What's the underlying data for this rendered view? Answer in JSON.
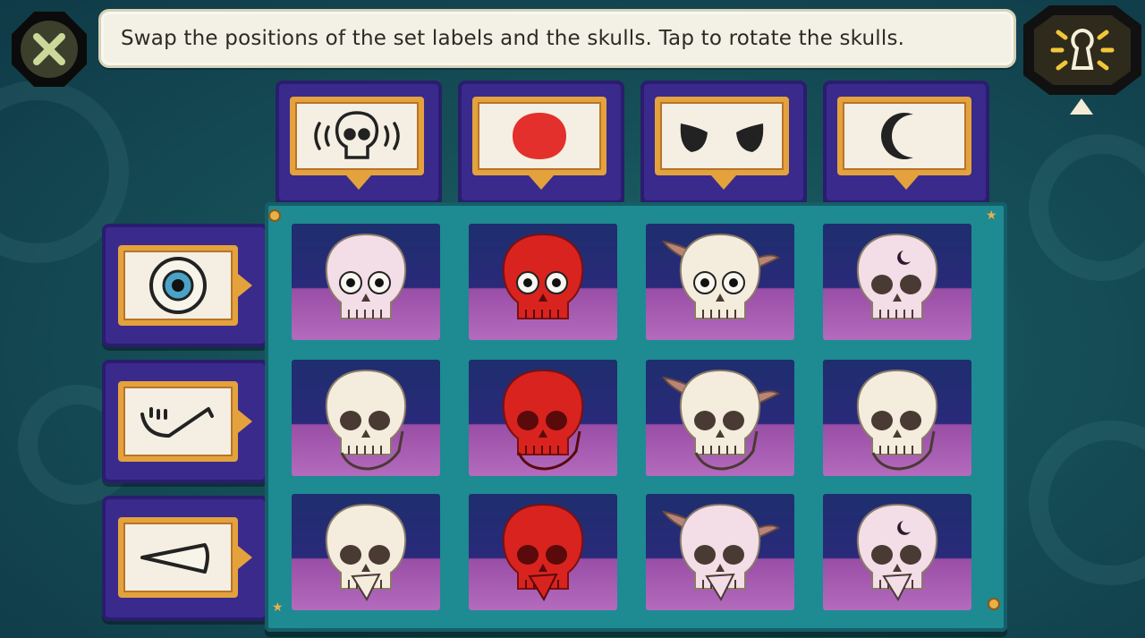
{
  "instruction": "Swap the positions of the set labels and the skulls. Tap to rotate the skulls.",
  "colors": {
    "shelf": "#1e8a92",
    "panel": "#3a2a8c",
    "label_frame": "#e4a23c",
    "skull_white": "#f4ecdc",
    "skull_pink": "#f3dde6",
    "skull_red": "#d8231f",
    "horn": "#b98578"
  },
  "column_labels": [
    {
      "icon": "shaking-skull-icon"
    },
    {
      "icon": "red-blob-icon"
    },
    {
      "icon": "angry-eyes-icon"
    },
    {
      "icon": "crescent-moon-icon"
    }
  ],
  "row_labels": [
    {
      "icon": "eyeball-icon"
    },
    {
      "icon": "jaw-icon"
    },
    {
      "icon": "beak-icon"
    }
  ],
  "skulls": [
    [
      {
        "color": "pink",
        "eyes": true,
        "horns": false,
        "moon": false,
        "jaw": false,
        "beak": false
      },
      {
        "color": "red",
        "eyes": true,
        "horns": false,
        "moon": false,
        "jaw": false,
        "beak": false
      },
      {
        "color": "white",
        "eyes": true,
        "horns": true,
        "moon": false,
        "jaw": false,
        "beak": false
      },
      {
        "color": "pink",
        "eyes": false,
        "horns": false,
        "moon": true,
        "jaw": false,
        "beak": false
      }
    ],
    [
      {
        "color": "white",
        "eyes": false,
        "horns": false,
        "moon": false,
        "jaw": true,
        "beak": false
      },
      {
        "color": "red",
        "eyes": false,
        "horns": false,
        "moon": false,
        "jaw": true,
        "beak": false
      },
      {
        "color": "white",
        "eyes": false,
        "horns": true,
        "moon": false,
        "jaw": true,
        "beak": false
      },
      {
        "color": "white",
        "eyes": false,
        "horns": false,
        "moon": false,
        "jaw": true,
        "beak": false
      }
    ],
    [
      {
        "color": "white",
        "eyes": false,
        "horns": false,
        "moon": false,
        "jaw": false,
        "beak": true
      },
      {
        "color": "red",
        "eyes": false,
        "horns": false,
        "moon": false,
        "jaw": false,
        "beak": true
      },
      {
        "color": "pink",
        "eyes": false,
        "horns": true,
        "moon": false,
        "jaw": false,
        "beak": true
      },
      {
        "color": "pink",
        "eyes": false,
        "horns": false,
        "moon": true,
        "jaw": false,
        "beak": true
      }
    ]
  ]
}
